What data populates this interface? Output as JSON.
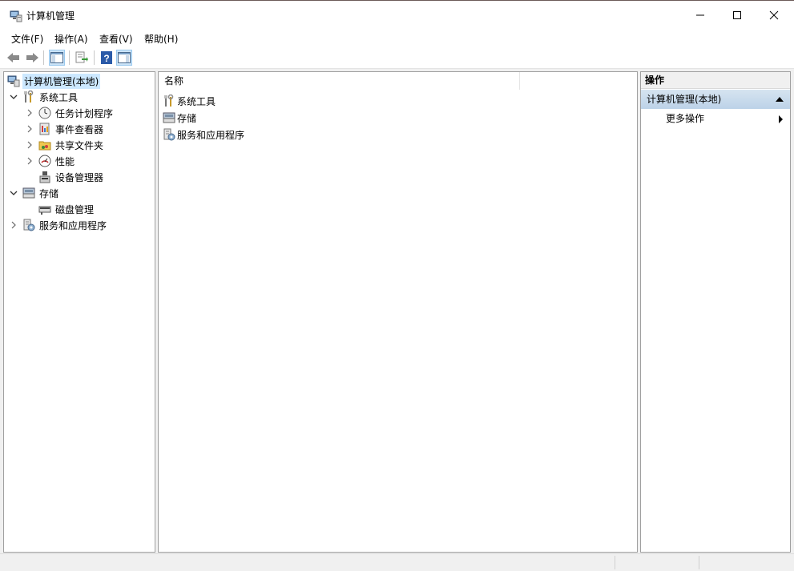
{
  "window": {
    "title": "计算机管理"
  },
  "menu": [
    {
      "label": "文件(F)"
    },
    {
      "label": "操作(A)"
    },
    {
      "label": "查看(V)"
    },
    {
      "label": "帮助(H)"
    }
  ],
  "tree": {
    "root": "计算机管理(本地)",
    "items": [
      {
        "label": "系统工具",
        "icon": "tools-icon",
        "state": "expanded"
      },
      {
        "label": "任务计划程序",
        "icon": "clock-icon",
        "state": "collapsed"
      },
      {
        "label": "事件查看器",
        "icon": "event-viewer-icon",
        "state": "collapsed"
      },
      {
        "label": "共享文件夹",
        "icon": "shared-folder-icon",
        "state": "collapsed"
      },
      {
        "label": "性能",
        "icon": "performance-icon",
        "state": "collapsed"
      },
      {
        "label": "设备管理器",
        "icon": "device-manager-icon",
        "state": "leaf"
      },
      {
        "label": "存储",
        "icon": "storage-icon",
        "state": "expanded"
      },
      {
        "label": "磁盘管理",
        "icon": "disk-icon",
        "state": "leaf"
      },
      {
        "label": "服务和应用程序",
        "icon": "services-icon",
        "state": "collapsed"
      }
    ]
  },
  "list": {
    "column": "名称",
    "rows": [
      {
        "label": "系统工具",
        "icon": "tools-icon"
      },
      {
        "label": "存储",
        "icon": "storage-icon"
      },
      {
        "label": "服务和应用程序",
        "icon": "services-icon"
      }
    ]
  },
  "actions": {
    "header": "操作",
    "group": "计算机管理(本地)",
    "item": "更多操作"
  },
  "colors": {
    "selection": "#cce8ff",
    "action_group": "#c8dcee"
  }
}
